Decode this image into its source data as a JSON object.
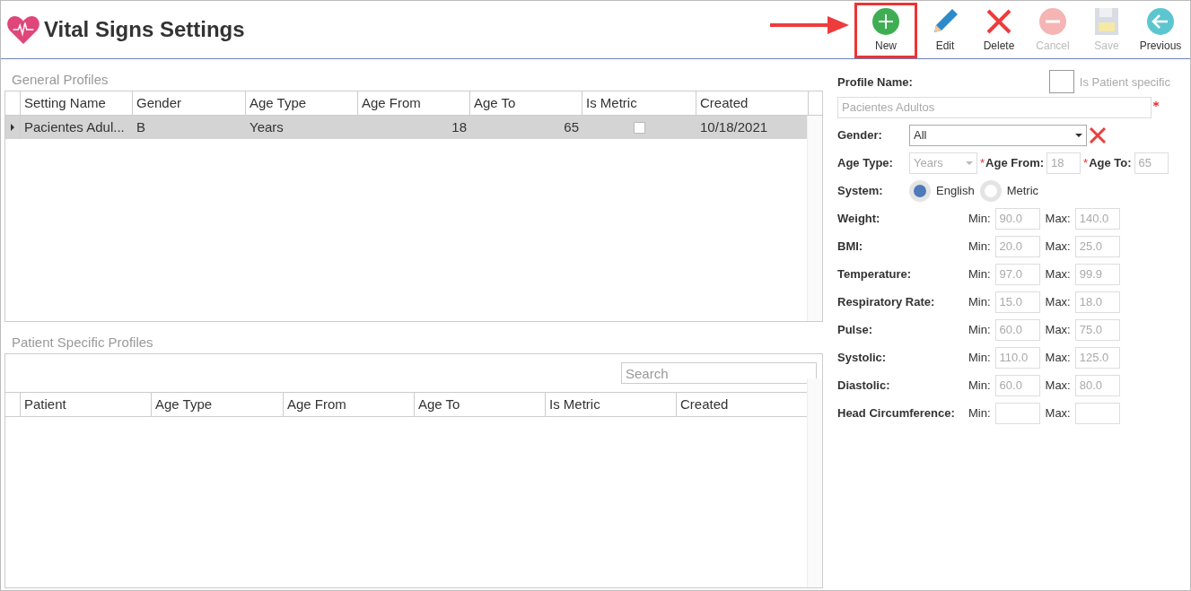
{
  "window": {
    "title": "Vital Signs Settings"
  },
  "toolbar": {
    "buttons": [
      {
        "label": "New",
        "kind": "new",
        "disabled": false,
        "highlighted": true
      },
      {
        "label": "Edit",
        "kind": "edit",
        "disabled": false,
        "highlighted": false
      },
      {
        "label": "Delete",
        "kind": "delete",
        "disabled": false,
        "highlighted": false
      },
      {
        "label": "Cancel",
        "kind": "cancel",
        "disabled": true,
        "highlighted": false
      },
      {
        "label": "Save",
        "kind": "save",
        "disabled": true,
        "highlighted": false
      },
      {
        "label": "Previous",
        "kind": "previous",
        "disabled": false,
        "highlighted": false
      }
    ]
  },
  "general_profiles": {
    "title": "General Profiles",
    "columns": [
      "Setting Name",
      "Gender",
      "Age Type",
      "Age From",
      "Age To",
      "Is Metric",
      "Created"
    ],
    "rows": [
      {
        "setting_name": "Pacientes Adul...",
        "gender": "B",
        "age_type": "Years",
        "age_from": "18",
        "age_to": "65",
        "is_metric": false,
        "created": "10/18/2021",
        "selected": true
      }
    ]
  },
  "patient_profiles": {
    "title": "Patient Specific Profiles",
    "search": {
      "placeholder": "Search"
    },
    "columns": [
      "Patient",
      "Age Type",
      "Age From",
      "Age To",
      "Is Metric",
      "Created"
    ]
  },
  "form": {
    "profile_name_label": "Profile Name:",
    "patient_specific": {
      "label": "Is Patient specific",
      "checked": false
    },
    "profile_name": {
      "value": "Pacientes Adultos",
      "disabled": true,
      "required": true
    },
    "gender_label": "Gender:",
    "gender": {
      "value": "All"
    },
    "age_type_label": "Age Type:",
    "age_type": {
      "value": "Years",
      "disabled": true
    },
    "age_from_label": "Age From:",
    "age_from": {
      "required_mark": "*",
      "value": "18",
      "disabled": true
    },
    "age_to_label": "Age To:",
    "age_to": {
      "required_mark": "*",
      "value": "65",
      "disabled": true
    },
    "system_label": "System:",
    "system_options": [
      {
        "label": "English",
        "selected": true
      },
      {
        "label": "Metric",
        "selected": false
      }
    ],
    "vitals": [
      {
        "label": "Weight:",
        "min_label": "Min:",
        "min": "90.0",
        "max_label": "Max:",
        "max": "140.0"
      },
      {
        "label": "BMI:",
        "min_label": "Min:",
        "min": "20.0",
        "max_label": "Max:",
        "max": "25.0"
      },
      {
        "label": "Temperature:",
        "min_label": "Min:",
        "min": "97.0",
        "max_label": "Max:",
        "max": "99.9"
      },
      {
        "label": "Respiratory Rate:",
        "min_label": "Min:",
        "min": "15.0",
        "max_label": "Max:",
        "max": "18.0"
      },
      {
        "label": "Pulse:",
        "min_label": "Min:",
        "min": "60.0",
        "max_label": "Max:",
        "max": "75.0"
      },
      {
        "label": "Systolic:",
        "min_label": "Min:",
        "min": "110.0",
        "max_label": "Max:",
        "max": "125.0"
      },
      {
        "label": "Diastolic:",
        "min_label": "Min:",
        "min": "60.0",
        "max_label": "Max:",
        "max": "80.0"
      },
      {
        "label": "Head Circumference:",
        "min_label": "Min:",
        "max_label": "Max:"
      }
    ]
  }
}
